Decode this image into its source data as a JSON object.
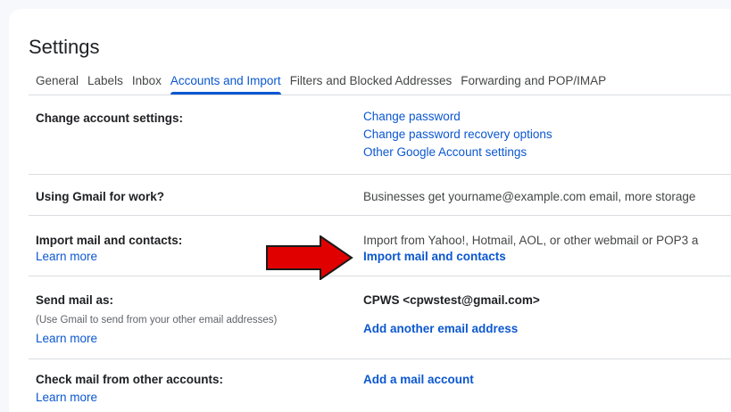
{
  "page": {
    "title": "Settings"
  },
  "tabs": [
    {
      "label": "General",
      "active": false
    },
    {
      "label": "Labels",
      "active": false
    },
    {
      "label": "Inbox",
      "active": false
    },
    {
      "label": "Accounts and Import",
      "active": true
    },
    {
      "label": "Filters and Blocked Addresses",
      "active": false
    },
    {
      "label": "Forwarding and POP/IMAP",
      "active": false
    }
  ],
  "sections": {
    "change_account": {
      "label": "Change account settings:",
      "links": [
        "Change password",
        "Change password recovery options",
        "Other Google Account settings"
      ]
    },
    "gmail_work": {
      "label": "Using Gmail for work?",
      "text": "Businesses get yourname@example.com email, more storage"
    },
    "import": {
      "label": "Import mail and contacts:",
      "learn_more": "Learn more",
      "text": "Import from Yahoo!, Hotmail, AOL, or other webmail or POP3 a",
      "action": "Import mail and contacts"
    },
    "send_as": {
      "label": "Send mail as:",
      "sub": "(Use Gmail to send from your other email addresses)",
      "learn_more": "Learn more",
      "address": "CPWS <cpwstest@gmail.com>",
      "action": "Add another email address"
    },
    "check_mail": {
      "label": "Check mail from other accounts:",
      "learn_more": "Learn more",
      "action": "Add a mail account"
    }
  },
  "colors": {
    "accent": "#0b57d0",
    "annotation_arrow": "#e00000"
  }
}
